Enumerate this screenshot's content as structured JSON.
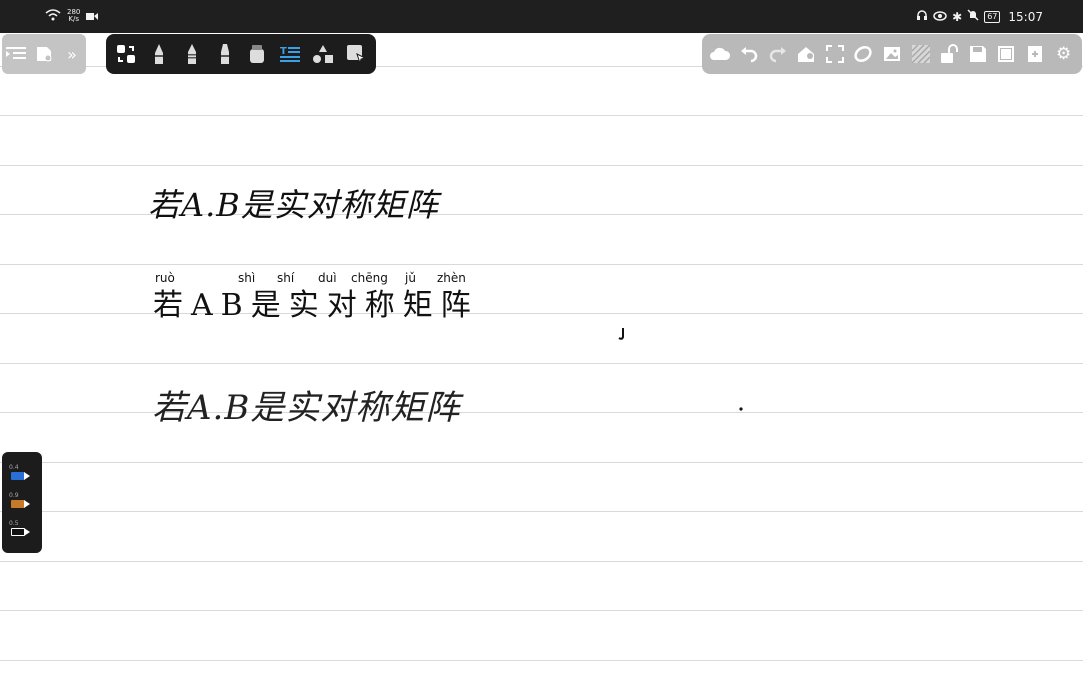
{
  "status_bar": {
    "net_speed_value": "280",
    "net_speed_unit": "K/s",
    "battery": "67",
    "time": "15:07"
  },
  "left_toolbar": {
    "icons": [
      "outline-icon",
      "page-icon",
      "expand-icon"
    ]
  },
  "pen_toolbar": {
    "icons": [
      "lasso-convert-icon",
      "fountain-pen-icon",
      "pencil-icon",
      "marker-icon",
      "eraser-icon",
      "text-icon",
      "shapes-icon",
      "select-icon"
    ]
  },
  "right_toolbar": {
    "icons": [
      "cloud-icon",
      "undo-icon",
      "redo-icon",
      "share-icon",
      "fullscreen-icon",
      "sync-icon",
      "insert-image-icon",
      "pattern-icon",
      "unlock-icon",
      "save-icon",
      "page-view-icon",
      "add-page-icon",
      "settings-icon"
    ]
  },
  "side_pens": [
    {
      "size": "0.4",
      "color": "#2a6fd6"
    },
    {
      "size": "0.9",
      "color": "#c57a2a"
    },
    {
      "size": "0.5",
      "color": "#111111"
    }
  ],
  "note": {
    "line1": "若A.B是实对称矩阵",
    "line2": "若AB是实对称矩阵",
    "line2_pinyin": [
      "ruò",
      "shì",
      "shí",
      "duì",
      "chēng",
      "jǔ",
      "zhèn"
    ],
    "line3": "若A.B是实对称矩阵"
  }
}
